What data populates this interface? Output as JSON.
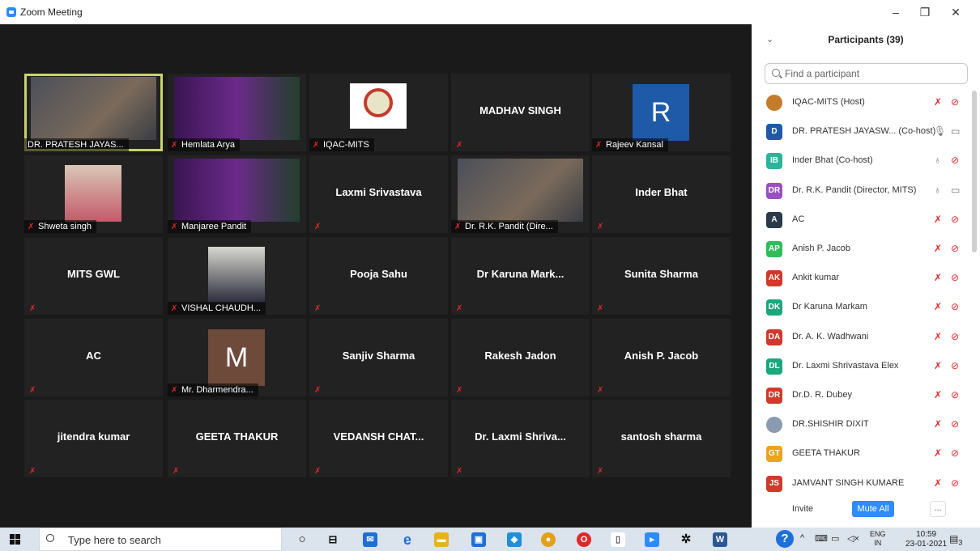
{
  "window": {
    "title": "Zoom Meeting"
  },
  "tiles": [
    {
      "name": "DR. PRATESH JAYAS...",
      "type": "video"
    },
    {
      "name": "Hemlata Arya",
      "type": "video"
    },
    {
      "name": "IQAC-MITS",
      "type": "logo"
    },
    {
      "name": "MADHAV SINGH",
      "type": "text"
    },
    {
      "name": "Rajeev Kansal",
      "type": "avatar",
      "letter": "R",
      "color": "#1f5aa8"
    },
    {
      "name": "Shweta singh",
      "type": "video"
    },
    {
      "name": "Manjaree Pandit",
      "type": "video"
    },
    {
      "name": "Laxmi Srivastava",
      "type": "text"
    },
    {
      "name": "Dr. R.K. Pandit (Dire...",
      "type": "video"
    },
    {
      "name": "Inder Bhat",
      "type": "text"
    },
    {
      "name": "MITS GWL",
      "type": "text"
    },
    {
      "name": "VISHAL CHAUDH...",
      "type": "video"
    },
    {
      "name": "Pooja Sahu",
      "type": "text"
    },
    {
      "name": "Dr Karuna Mark...",
      "type": "text"
    },
    {
      "name": "Sunita Sharma",
      "type": "text"
    },
    {
      "name": "AC",
      "type": "text"
    },
    {
      "name": "Mr. Dharmendra...",
      "type": "avatar",
      "letter": "M",
      "color": "#6e4a3b"
    },
    {
      "name": "Sanjiv Sharma",
      "type": "text"
    },
    {
      "name": "Rakesh Jadon",
      "type": "text"
    },
    {
      "name": "Anish P. Jacob",
      "type": "text"
    },
    {
      "name": "jitendra kumar",
      "type": "text"
    },
    {
      "name": "GEETA THAKUR",
      "type": "text"
    },
    {
      "name": "VEDANSH CHAT...",
      "type": "text"
    },
    {
      "name": "Dr. Laxmi Shriva...",
      "type": "text"
    },
    {
      "name": "santosh sharma",
      "type": "text"
    }
  ],
  "participants_panel": {
    "title": "Participants (39)",
    "search_placeholder": "Find a participant",
    "participants": [
      {
        "initials": "",
        "name": "IQAC-MITS (Host)",
        "color": "#c47b2a",
        "mic": "muted",
        "cam": "off"
      },
      {
        "initials": "D",
        "name": "DR. PRATESH JAYASW... (Co-host)",
        "color": "#1f5aa8",
        "mic": "on",
        "cam": "on"
      },
      {
        "initials": "IB",
        "name": "Inder Bhat (Co-host)",
        "color": "#2bb59a",
        "mic": "unmuted",
        "cam": "off"
      },
      {
        "initials": "DR",
        "name": "Dr. R.K. Pandit (Director, MITS)",
        "color": "#9a4fc4",
        "mic": "unmuted",
        "cam": "on"
      },
      {
        "initials": "A",
        "name": "AC",
        "color": "#2b3a4a",
        "mic": "muted",
        "cam": "off"
      },
      {
        "initials": "AP",
        "name": "Anish P. Jacob",
        "color": "#2ebd59",
        "mic": "muted",
        "cam": "off"
      },
      {
        "initials": "AK",
        "name": "Ankit kumar",
        "color": "#d0392b",
        "mic": "muted",
        "cam": "off"
      },
      {
        "initials": "DK",
        "name": "Dr Karuna Markam",
        "color": "#1aa77e",
        "mic": "muted",
        "cam": "off"
      },
      {
        "initials": "DA",
        "name": "Dr. A. K. Wadhwani",
        "color": "#d0392b",
        "mic": "muted",
        "cam": "off"
      },
      {
        "initials": "DL",
        "name": "Dr. Laxmi Shrivastava Elex",
        "color": "#1aa77e",
        "mic": "muted",
        "cam": "off"
      },
      {
        "initials": "DR",
        "name": "Dr.D. R. Dubey",
        "color": "#d0392b",
        "mic": "muted",
        "cam": "off"
      },
      {
        "initials": "",
        "name": "DR.SHISHIR DIXIT",
        "color": "#8a9ab0",
        "mic": "muted",
        "cam": "off"
      },
      {
        "initials": "GT",
        "name": "GEETA THAKUR",
        "color": "#f0a21a",
        "mic": "muted",
        "cam": "off"
      },
      {
        "initials": "JS",
        "name": "JAMVANT SINGH KUMARE",
        "color": "#d0392b",
        "mic": "muted",
        "cam": "off"
      }
    ],
    "invite_label": "Invite",
    "mute_all_label": "Mute All",
    "more_label": "..."
  },
  "taskbar": {
    "search_placeholder": "Type here to search",
    "lang_top": "ENG",
    "lang_bottom": "IN",
    "time": "10:59",
    "date": "23-01-2021",
    "notification_count": "3"
  }
}
